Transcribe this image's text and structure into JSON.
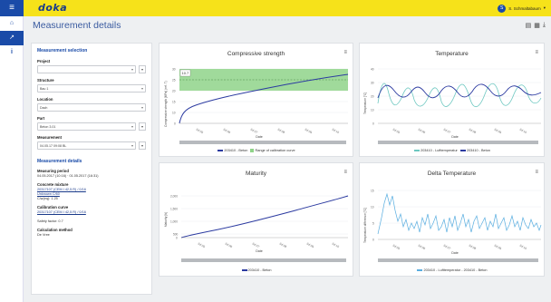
{
  "header": {
    "logo": "doka",
    "menu_icon": "menu-icon",
    "user_initial": "S",
    "user_name": "S. Schmaltabaum"
  },
  "rail": {
    "items": [
      {
        "icon": "home-icon",
        "glyph": "⌂"
      },
      {
        "icon": "chart-icon",
        "glyph": "↗"
      },
      {
        "icon": "info-icon",
        "glyph": "i"
      }
    ]
  },
  "page": {
    "title": "Measurement details"
  },
  "selection": {
    "title": "Measurement selection",
    "project_label": "Project",
    "project_value": "",
    "structure_label": "Structure",
    "structure_value": "Bau 1",
    "location_label": "Location",
    "location_value": "Dach",
    "part_label": "Part",
    "part_value": "Beton 3.01",
    "measurement_label": "Measurement",
    "measurement_value": "04.05.17 09:08 BL"
  },
  "details": {
    "title": "Measurement details",
    "period_label": "Measuring period",
    "period_value": "04.05.2017 (10:16) · 01.05.2017 (16:31)",
    "mixture_label": "Concrete mixture",
    "mixture_link1": "20317107 (CEM I 42,5 R) / 0/16",
    "mixture_link2": "Unknown C/60",
    "mixture_w": "C/w(eq): 1.25",
    "calib_label": "Calibration curve",
    "calib_link": "20317107 (CEM I 42,5 R) / 0/16",
    "safety": "Safety factor: 0.7",
    "method_label": "Calculation method",
    "method_value": "De Vree"
  },
  "charts": {
    "compressive": {
      "title": "Compressive strength",
      "ylabel": "Compressive strength [MPa] (ref. T)",
      "xlabel": "Date",
      "band_label": "10.7",
      "ticks": [
        "Jul 05",
        "Jul 06",
        "Jul 07",
        "Jul 08",
        "Jul 09",
        "Jul 10"
      ],
      "yticks": [
        "30",
        "25",
        "20",
        "15",
        "10",
        "5",
        "0"
      ],
      "legend_a": "203410 - Beton",
      "legend_b": "Range of calibration curve"
    },
    "temperature": {
      "title": "Temperature",
      "ylabel": "Temperature [°C]",
      "xlabel": "Date",
      "ticks": [
        "Jul 05",
        "Jul 06",
        "Jul 07",
        "Jul 08",
        "Jul 09",
        "Jul 10"
      ],
      "yticks": [
        "40",
        "30",
        "20",
        "10",
        "0"
      ],
      "legend_a": "203410 - Lufttemperatur",
      "legend_b": "203410 - Beton"
    },
    "maturity": {
      "title": "Maturity",
      "ylabel": "Maturity [h]",
      "xlabel": "Date",
      "ticks": [
        "Jul 05",
        "Jul 06",
        "Jul 07",
        "Jul 08",
        "Jul 09",
        "Jul 10"
      ],
      "yticks": [
        "2,000",
        "1,500",
        "1,000",
        "500",
        "0"
      ],
      "legend_a": "203410 - Beton"
    },
    "delta": {
      "title": "Delta Temperature",
      "ylabel": "Temperature difference [°C]",
      "xlabel": "Date",
      "ticks": [
        "Jul 05",
        "Jul 06",
        "Jul 07",
        "Jul 08",
        "Jul 09",
        "Jul 10"
      ],
      "yticks": [
        "15",
        "10",
        "5",
        "0"
      ],
      "legend_a": "203410 - Lufttemperatur - 203410 - Beton"
    }
  },
  "colors": {
    "accent": "#f6e21a",
    "primary": "#1a4ba8",
    "series_dark": "#2b3aa0",
    "series_light": "#6cc7c0",
    "band": "#8fd389"
  }
}
